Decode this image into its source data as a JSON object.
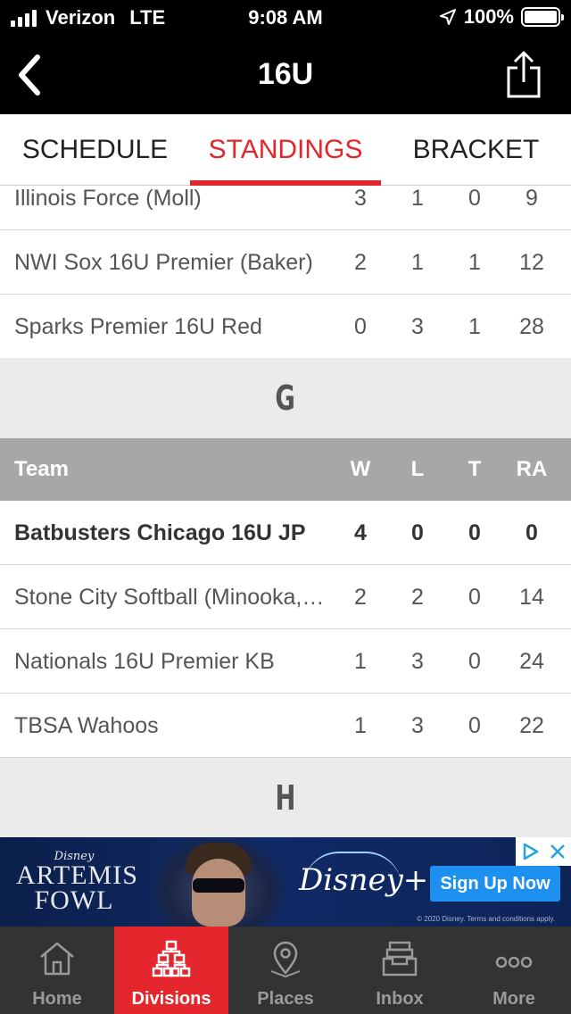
{
  "status_bar": {
    "carrier": "Verizon",
    "network": "LTE",
    "time": "9:08 AM",
    "battery": "100%"
  },
  "nav": {
    "title": "16U",
    "back_icon": "chevron-left-icon",
    "share_icon": "share-icon"
  },
  "tabs": [
    {
      "label": "SCHEDULE",
      "active": false
    },
    {
      "label": "STANDINGS",
      "active": true
    },
    {
      "label": "BRACKET",
      "active": false
    }
  ],
  "group_f_rows": [
    {
      "team": "Illinois Force (Moll)",
      "w": "3",
      "l": "1",
      "t": "0",
      "ra": "9"
    },
    {
      "team": "NWI Sox 16U Premier (Baker)",
      "w": "2",
      "l": "1",
      "t": "1",
      "ra": "12"
    },
    {
      "team": "Sparks Premier 16U Red",
      "w": "0",
      "l": "3",
      "t": "1",
      "ra": "28"
    }
  ],
  "group_g": {
    "title": "G",
    "columns": {
      "team": "Team",
      "w": "W",
      "l": "L",
      "t": "T",
      "ra": "RA"
    },
    "rows": [
      {
        "team": "Batbusters Chicago 16U JP",
        "w": "4",
        "l": "0",
        "t": "0",
        "ra": "0",
        "bold": true
      },
      {
        "team": "Stone City Softball (Minooka,…",
        "w": "2",
        "l": "2",
        "t": "0",
        "ra": "14"
      },
      {
        "team": "Nationals 16U Premier KB",
        "w": "1",
        "l": "3",
        "t": "0",
        "ra": "24"
      },
      {
        "team": "TBSA Wahoos",
        "w": "1",
        "l": "3",
        "t": "0",
        "ra": "22"
      }
    ]
  },
  "group_h": {
    "title": "H"
  },
  "ad": {
    "brand_small": "Disney",
    "title_line1": "ARTEMIS",
    "title_line2": "FOWL",
    "service": "Disney+",
    "cta": "Sign Up Now",
    "legal": "© 2020 Disney. Terms and conditions apply."
  },
  "tabbar": [
    {
      "label": "Home",
      "icon": "home-icon",
      "active": false
    },
    {
      "label": "Divisions",
      "icon": "bracket-tree-icon",
      "active": true
    },
    {
      "label": "Places",
      "icon": "map-pin-icon",
      "active": false
    },
    {
      "label": "Inbox",
      "icon": "inbox-icon",
      "active": false
    },
    {
      "label": "More",
      "icon": "more-dots-icon",
      "active": false
    }
  ],
  "colors": {
    "accent": "#e3272c",
    "header_gray": "#a7a7a7",
    "group_bg": "#ebebeb",
    "tabbar_bg": "#333333"
  }
}
